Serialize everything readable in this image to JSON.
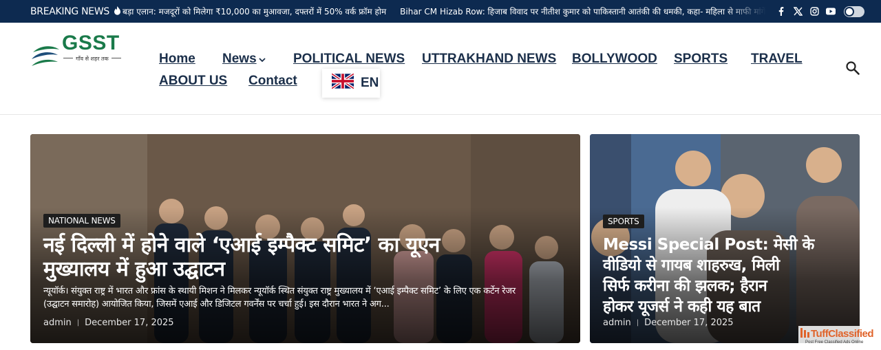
{
  "topbar": {
    "breaking_label": "BREAKING NEWS",
    "ticker_items": [
      "बड़ा एलान: मजदूरों को मिलेगा ₹10,000 का मुआवजा, दफ्तरों में 50% वर्क फ्रॉम होम",
      "Bihar CM Hizab Row: हिजाब विवाद पर नीतीश कुमार को पाकिस्तानी आतंकी की धमकी, कहा- महिला से माफी मांगें, वरना"
    ],
    "social_icons": [
      "facebook-icon",
      "x-icon",
      "instagram-icon",
      "youtube-icon"
    ]
  },
  "logo": {
    "text": "GSST",
    "tagline": "गाँव से शहर तक"
  },
  "nav": {
    "home": "Home",
    "news": "News",
    "political": "POLITICAL NEWS",
    "uttrakhand": "UTTRAKHAND NEWS",
    "bollywood": "BOLLYWOOD",
    "sports": "SPORTS",
    "travel": "TRAVEL",
    "about": "ABOUT US",
    "contact": "Contact",
    "language": "EN"
  },
  "featured": {
    "category": "NATIONAL NEWS",
    "title_line1": "नई दिल्ली में होने वाले ‘एआई इम्पैक्ट समिट’ का यूएन",
    "title_line2": "मुख्यालय में हुआ उद्घाटन",
    "excerpt_line1": "न्यूयॉर्क। संयुक्त राष्ट्र में भारत और फ्रांस के स्थायी मिशन ने मिलकर न्यूयॉर्क स्थित संयुक्त राष्ट्र मुख्यालय में ‘एआई इम्पैक्ट समिट’ के लिए एक कर्टेन रेजर",
    "excerpt_line2": "(उद्घाटन समारोह) आयोजित किया, जिसमें एआई और डिजिटल गवर्नेंस पर चर्चा हुई। इस दौरान भारत ने अग...",
    "author": "admin",
    "date": "December 17, 2025"
  },
  "side": {
    "category": "SPORTS",
    "title_line1": "Messi Special Post: मेसी के",
    "title_line2": "वीडियो से गायब शाहरुख, मिली",
    "title_line3": "सिर्फ करीना की झलक; हैरान",
    "title_line4": "होकर यूजर्स ने कही यह बात",
    "author": "admin",
    "date": "December 17, 2025"
  },
  "watermark": {
    "brand": "TuffClassified",
    "tagline": "Post Free Classified Ads Online"
  },
  "colors": {
    "topbar": "#0d2a50",
    "nav_text": "#1b2f4a",
    "logo_green": "#1a7a4a",
    "logo_blue": "#1e4e7a"
  }
}
